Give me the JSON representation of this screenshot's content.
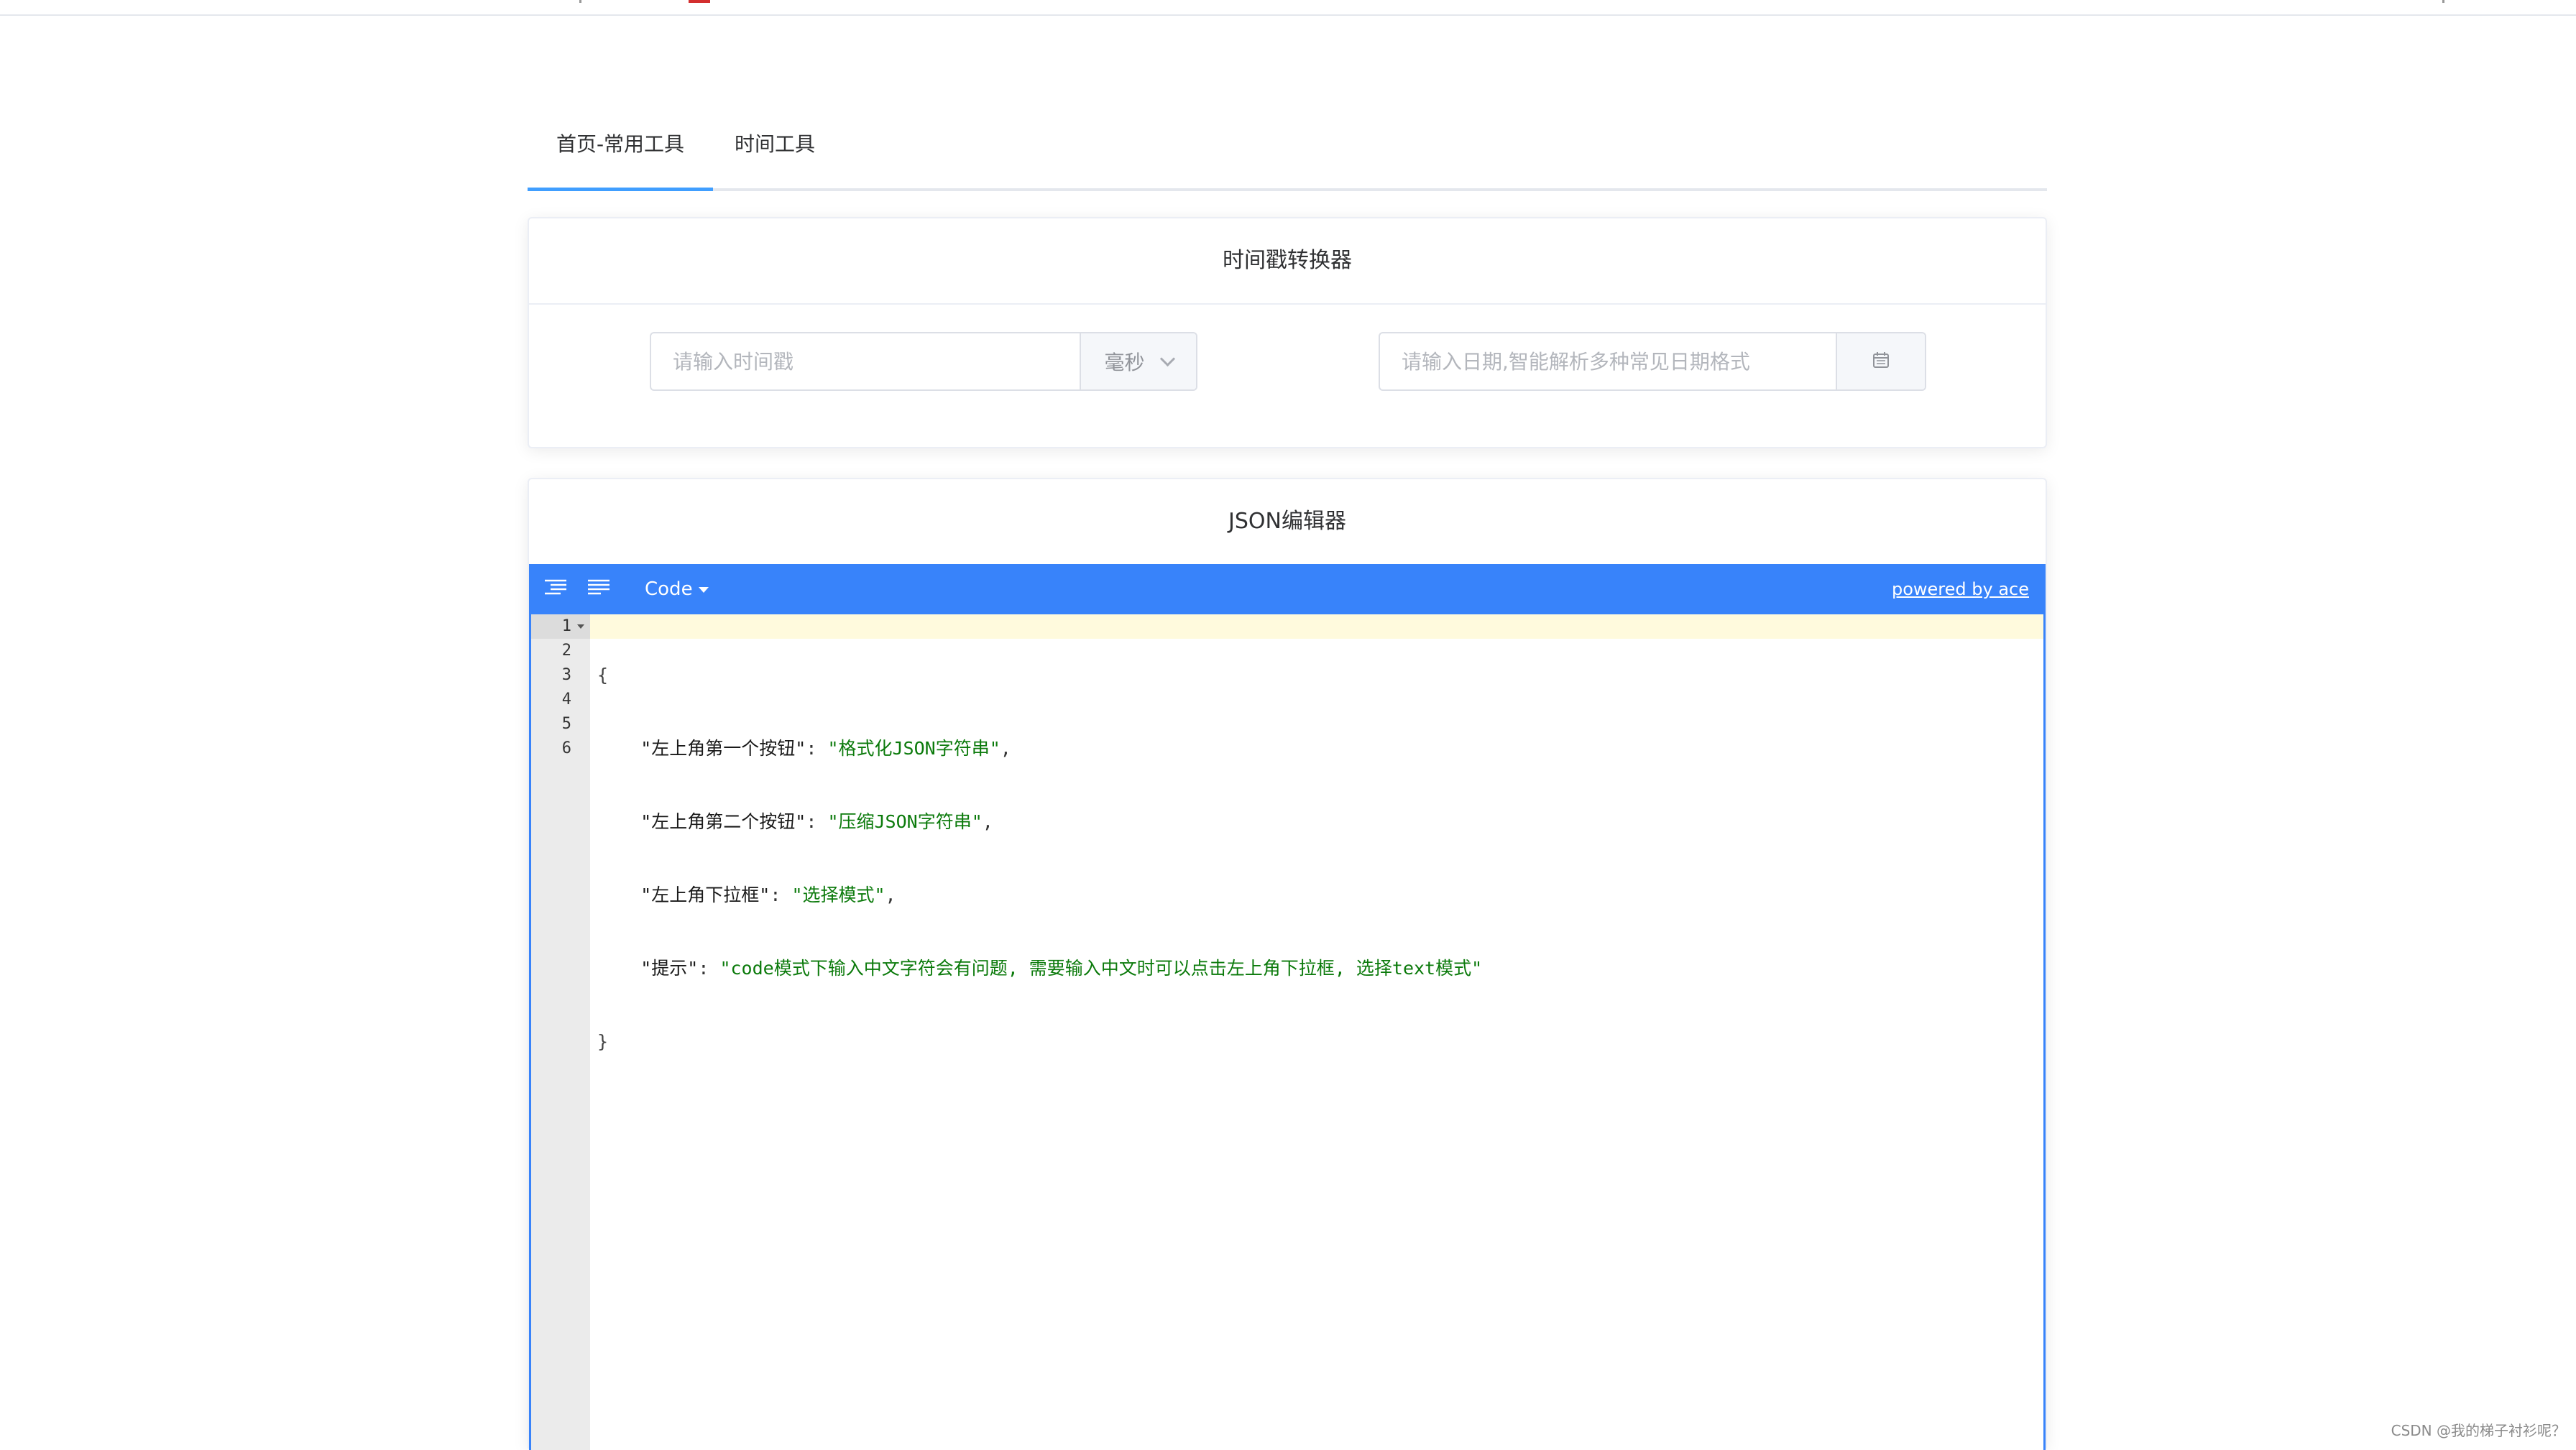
{
  "tabs": [
    {
      "label": "首页-常用工具",
      "active": true
    },
    {
      "label": "时间工具",
      "active": false
    }
  ],
  "timestamp_card": {
    "title": "时间戳转换器",
    "timestamp_placeholder": "请输入时间戳",
    "unit_selected": "毫秒",
    "date_placeholder": "请输入日期,智能解析多种常见日期格式",
    "calendar_icon": "calendar-icon"
  },
  "json_card": {
    "title": "JSON编辑器",
    "menu": {
      "format_icon": "format-icon",
      "compact_icon": "compact-icon",
      "mode_label": "Code",
      "powered_by": "powered by ace"
    },
    "line_numbers": [
      "1",
      "2",
      "3",
      "4",
      "5",
      "6"
    ],
    "code": {
      "open_brace": "{",
      "close_brace": "}",
      "entries": [
        {
          "key": "\"左上角第一个按钮\"",
          "value": "\"格式化JSON字符串\"",
          "comma": ","
        },
        {
          "key": "\"左上角第二个按钮\"",
          "value": "\"压缩JSON字符串\"",
          "comma": ","
        },
        {
          "key": "\"左上角下拉框\"",
          "value": "\"选择模式\"",
          "comma": ","
        },
        {
          "key": "\"提示\"",
          "value": "\"code模式下输入中文字符会有问题, 需要输入中文时可以点击左上角下拉框, 选择text模式\"",
          "comma": ""
        }
      ]
    }
  },
  "watermark": "CSDN @我的梯子衬衫呢？",
  "colors": {
    "accent": "#409eff",
    "editor_blue": "#3883fa",
    "string_green": "#0b7a0b",
    "active_line": "#fffadd"
  }
}
